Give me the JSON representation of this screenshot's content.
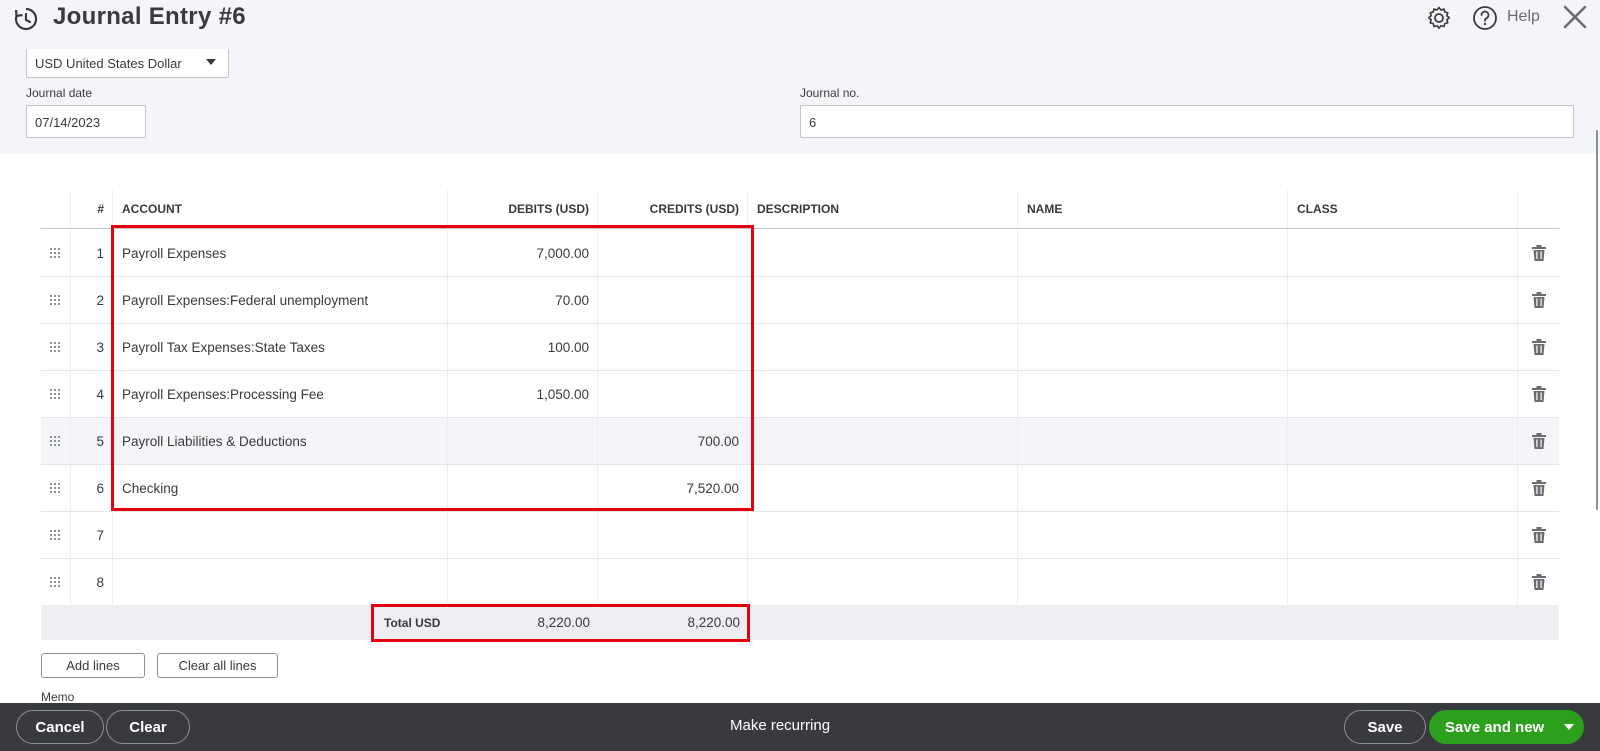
{
  "header": {
    "title": "Journal Entry #6",
    "help_label": "Help"
  },
  "form": {
    "currency": "USD United States Dollar",
    "journal_date_label": "Journal date",
    "journal_date": "07/14/2023",
    "journal_no_label": "Journal no.",
    "journal_no": "6"
  },
  "table": {
    "columns": [
      "#",
      "ACCOUNT",
      "DEBITS (USD)",
      "CREDITS (USD)",
      "DESCRIPTION",
      "NAME",
      "CLASS"
    ],
    "rows": [
      {
        "num": "1",
        "account": "Payroll Expenses",
        "debit": "7,000.00",
        "credit": "",
        "description": "",
        "name": "",
        "class": ""
      },
      {
        "num": "2",
        "account": "Payroll Expenses:Federal unemployment",
        "debit": "70.00",
        "credit": "",
        "description": "",
        "name": "",
        "class": ""
      },
      {
        "num": "3",
        "account": "Payroll Tax Expenses:State Taxes",
        "debit": "100.00",
        "credit": "",
        "description": "",
        "name": "",
        "class": ""
      },
      {
        "num": "4",
        "account": "Payroll Expenses:Processing Fee",
        "debit": "1,050.00",
        "credit": "",
        "description": "",
        "name": "",
        "class": ""
      },
      {
        "num": "5",
        "account": "Payroll Liabilities & Deductions",
        "debit": "",
        "credit": "700.00",
        "description": "",
        "name": "",
        "class": ""
      },
      {
        "num": "6",
        "account": "Checking",
        "debit": "",
        "credit": "7,520.00",
        "description": "",
        "name": "",
        "class": ""
      },
      {
        "num": "7",
        "account": "",
        "debit": "",
        "credit": "",
        "description": "",
        "name": "",
        "class": ""
      },
      {
        "num": "8",
        "account": "",
        "debit": "",
        "credit": "",
        "description": "",
        "name": "",
        "class": ""
      }
    ],
    "total_label": "Total USD",
    "total_debit": "8,220.00",
    "total_credit": "8,220.00"
  },
  "actions": {
    "add_lines": "Add lines",
    "clear_all_lines": "Clear all lines",
    "memo_label": "Memo"
  },
  "footer": {
    "cancel": "Cancel",
    "clear": "Clear",
    "make_recurring": "Make recurring",
    "save": "Save",
    "save_and_new": "Save and new"
  },
  "colors": {
    "primary_green": "#2ca01c",
    "footer_bg": "#393a3d",
    "highlight_red": "#e4000f"
  }
}
